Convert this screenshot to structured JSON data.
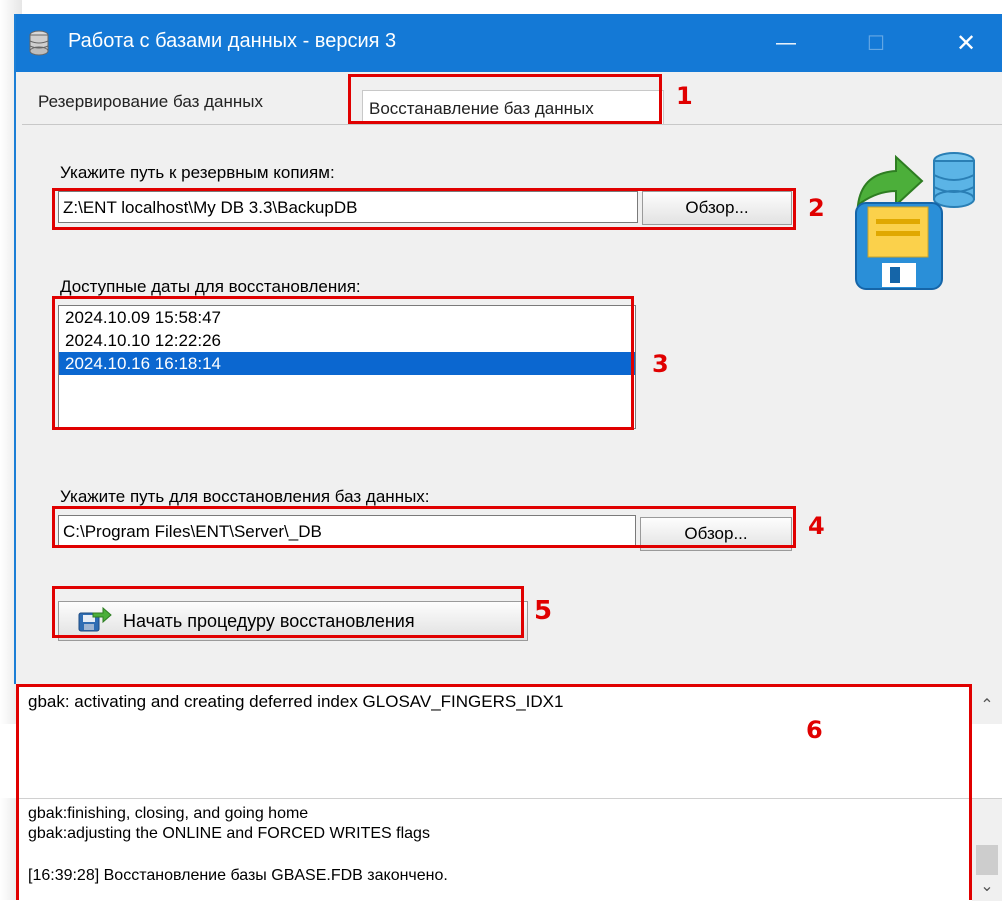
{
  "window": {
    "title": "Работа с базами данных - версия 3",
    "minimize_glyph": "—",
    "maximize_glyph": "☐",
    "close_glyph": "✕"
  },
  "tabs": [
    {
      "label": "Резервирование баз данных"
    },
    {
      "label": "Восстанавление баз данных"
    }
  ],
  "restore": {
    "backup_path_label": "Укажите путь к резервным копиям:",
    "backup_path_value": "Z:\\ENT localhost\\My DB 3.3\\BackupDB",
    "browse_label": "Обзор...",
    "dates_label": "Доступные даты для восстановления:",
    "dates": [
      "2024.10.09 15:58:47",
      "2024.10.10 12:22:26",
      "2024.10.16 16:18:14"
    ],
    "selected_date_index": 2,
    "restore_path_label": "Укажите путь для восстановления баз данных:",
    "restore_path_value": "C:\\Program Files\\ENT\\Server\\_DB",
    "browse2_label": "Обзор...",
    "start_button_label": "Начать процедуру восстановления"
  },
  "callouts": [
    "1",
    "2",
    "3",
    "4",
    "5",
    "6"
  ],
  "log": {
    "top_line": "gbak:    activating and creating deferred index GLOSAV_FINGERS_IDX1",
    "lines": [
      "gbak:finishing, closing, and going home",
      "gbak:adjusting the ONLINE and FORCED WRITES flags",
      "",
      "[16:39:28] Восстановление базы GBASE.FDB закончено."
    ]
  },
  "colors": {
    "titlebar": "#1479d6",
    "selection": "#0b67d0",
    "annotation": "#e00000"
  }
}
